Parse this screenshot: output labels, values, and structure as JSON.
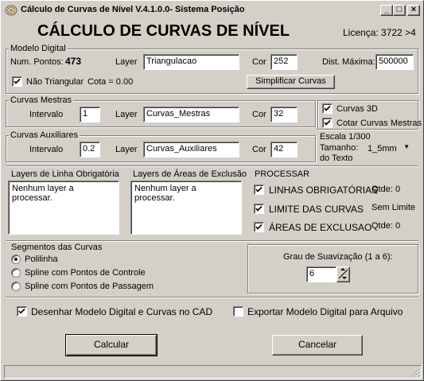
{
  "window": {
    "title": "Cálculo de Curvas de Nível V.4.1.0.0- Sistema Posição",
    "min_glyph": "_",
    "max_glyph": "□",
    "close_glyph": "×"
  },
  "header": {
    "heading": "CÁLCULO DE CURVAS DE NÍVEL",
    "license": "Licença: 3722 >4"
  },
  "modelo_digital": {
    "group_label": "Modelo Digital",
    "num_pontos_label": "Num. Pontos:",
    "num_pontos_value": "473",
    "layer_label": "Layer",
    "layer_value": "Triangulacao",
    "cor_label": "Cor",
    "cor_value": "252",
    "dist_max_label": "Dist. Máxima:",
    "dist_max_value": "500000",
    "nao_triangular_label": "Não Triangular",
    "nao_triangular_checked": true,
    "cota_text": "Cota = 0.00",
    "simplificar_label": "Simplificar Curvas"
  },
  "curvas_mestras": {
    "group_label": "Curvas Mestras",
    "intervalo_label": "Intervalo",
    "intervalo_value": "1",
    "layer_label": "Layer",
    "layer_value": "Curvas_Mestras",
    "cor_label": "Cor",
    "cor_value": "32"
  },
  "curvas_auxiliares": {
    "group_label": "Curvas Auxiliares",
    "intervalo_label": "Intervalo",
    "intervalo_value": "0.2",
    "layer_label": "Layer",
    "layer_value": "Curvas_Auxiliares",
    "cor_label": "Cor",
    "cor_value": "42"
  },
  "options_right": {
    "curvas_3d_label": "Curvas 3D",
    "curvas_3d_checked": true,
    "cotar_label": "Cotar Curvas Mestras",
    "cotar_checked": true,
    "escala_label": "Escala 1/300",
    "tamanho_label_1": "Tamanho:",
    "tamanho_label_2": "do Texto",
    "tamanho_value": "1_5mm"
  },
  "layers_obrigatoria": {
    "label": "Layers de Linha Obrigatória",
    "content": "Nenhum layer a processar."
  },
  "layers_exclusao": {
    "label": "Layers de Áreas de Exclusão",
    "content": "Nenhum layer a processar."
  },
  "processar": {
    "label": "PROCESSAR",
    "items": [
      {
        "label": "LINHAS OBRIGATÓRIAS",
        "qtde": "Qtde: 0",
        "checked": true
      },
      {
        "label": "LIMITE DAS CURVAS",
        "qtde": "Sem Limite",
        "checked": true
      },
      {
        "label": "ÁREAS DE EXCLUSAO",
        "qtde": "Qtde: 0",
        "checked": true
      }
    ]
  },
  "segmentos": {
    "label": "Segmentos das Curvas",
    "options": [
      {
        "label": "Polilinha",
        "selected": true
      },
      {
        "label": "Spline com Pontos de Controle",
        "selected": false
      },
      {
        "label": "Spline com Pontos de Passagem",
        "selected": false
      }
    ]
  },
  "suavizacao": {
    "label": "Grau de Suavização (1 a 6):",
    "value": "6"
  },
  "bottom": {
    "desenhar_label": "Desenhar Modelo Digital e Curvas no CAD",
    "desenhar_checked": true,
    "exportar_label": "Exportar Modelo Digital para Arquivo",
    "exportar_checked": false,
    "calcular_label": "Calcular",
    "cancelar_label": "Cancelar"
  }
}
